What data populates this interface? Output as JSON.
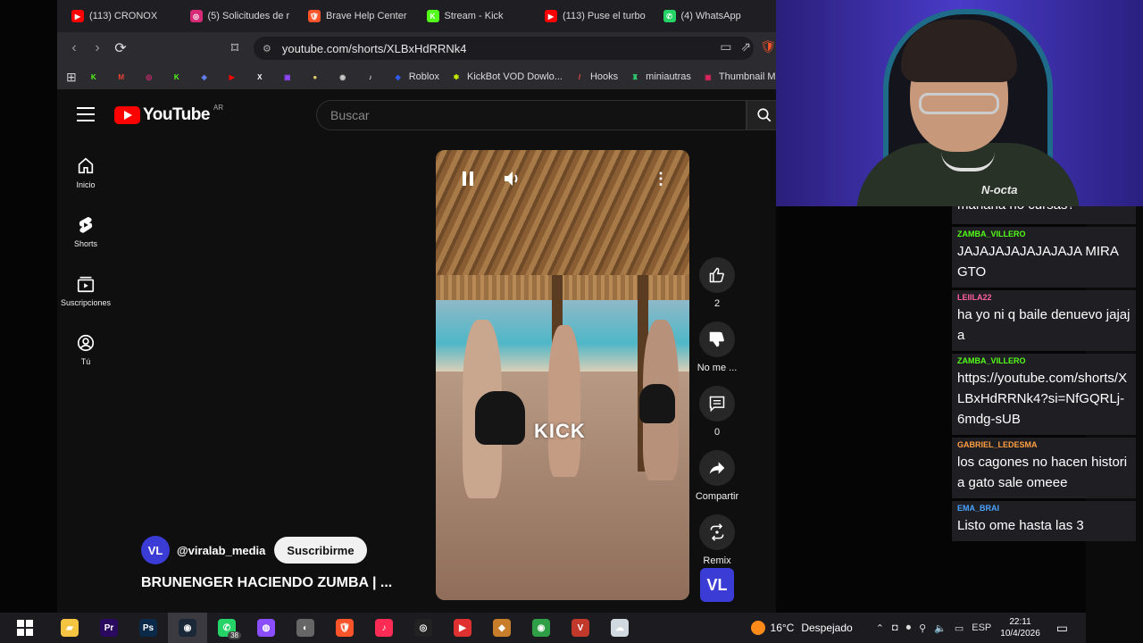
{
  "tabs": [
    {
      "label": "(113) CRONOX",
      "color": "#ff0000",
      "glyph": "▶"
    },
    {
      "label": "(5) Solicitudes de r",
      "color": "#d62976",
      "glyph": "◎"
    },
    {
      "label": "Brave Help Center",
      "color": "#fb542b",
      "glyph": "🛡"
    },
    {
      "label": "Stream - Kick",
      "color": "#53fc18",
      "glyph": "K"
    },
    {
      "label": "(113) Puse el turbo",
      "color": "#ff0000",
      "glyph": "▶"
    },
    {
      "label": "(4) WhatsApp",
      "color": "#25d366",
      "glyph": "✆"
    }
  ],
  "address": {
    "url": "youtube.com/shorts/XLBxHdRRNk4"
  },
  "bookmarks": [
    {
      "label": "",
      "color": "#53fc18",
      "glyph": "K"
    },
    {
      "label": "",
      "color": "#ea4335",
      "glyph": "M"
    },
    {
      "label": "",
      "color": "#d62976",
      "glyph": "◎"
    },
    {
      "label": "",
      "color": "#53fc18",
      "glyph": "K"
    },
    {
      "label": "",
      "color": "#627eea",
      "glyph": "◆"
    },
    {
      "label": "",
      "color": "#ff0000",
      "glyph": "▶"
    },
    {
      "label": "",
      "color": "#ffffff",
      "glyph": "X"
    },
    {
      "label": "",
      "color": "#9146ff",
      "glyph": "▣"
    },
    {
      "label": "",
      "color": "#e7d36a",
      "glyph": "●"
    },
    {
      "label": "",
      "color": "#cccccc",
      "glyph": "◉"
    },
    {
      "label": "",
      "color": "#ffffff",
      "glyph": "♪"
    },
    {
      "label": "Roblox",
      "color": "#335fff",
      "glyph": "◈"
    },
    {
      "label": "KickBot VOD Dowlo...",
      "color": "#c7f000",
      "glyph": "✱"
    },
    {
      "label": "Hooks",
      "color": "#ff4b4b",
      "glyph": "/"
    },
    {
      "label": "miniautras",
      "color": "#2ecc71",
      "glyph": "♜"
    },
    {
      "label": "Thumbnail M",
      "color": "#e0245e",
      "glyph": "▣"
    }
  ],
  "youtube": {
    "logo_text": "YouTube",
    "region": "AR",
    "search_placeholder": "Buscar",
    "nav": [
      {
        "label": "Inicio",
        "icon": "home-icon"
      },
      {
        "label": "Shorts",
        "icon": "shorts-icon"
      },
      {
        "label": "Suscripciones",
        "icon": "subscriptions-icon"
      },
      {
        "label": "Tú",
        "icon": "you-icon"
      }
    ],
    "video": {
      "watermark": "KICK"
    },
    "actions": {
      "likes": "2",
      "dislike": "No me ...",
      "comments": "0",
      "share": "Compartir",
      "remix": "Remix"
    },
    "channel": {
      "avatar_text": "VL",
      "handle": "@viralab_media",
      "subscribe": "Suscribirme"
    },
    "title": "BRUNENGER HACIENDO ZUMBA | ..."
  },
  "webcam": {
    "shirt_text": "N-octa"
  },
  "chat": [
    {
      "user": "",
      "text": "mañana no cursas?",
      "color": "#ffffff",
      "cut": true
    },
    {
      "user": "ZAMBA_VILLERO",
      "text": "JAJAJAJAJAJAJAJA MIRA GTO",
      "color": "#53fc18"
    },
    {
      "user": "LEIILA22",
      "text": "ha yo ni q baile denuevo jajaja",
      "color": "#ff5fa2"
    },
    {
      "user": "ZAMBA_VILLERO",
      "text": "https://youtube.com/shorts/XLBxHdRRNk4?si=NfGQRLj-6mdg-sUB",
      "color": "#53fc18"
    },
    {
      "user": "GABRIEL_LEDESMA",
      "text": "los cagones no hacen historia gato sale omeee",
      "color": "#ff9f43"
    },
    {
      "user": "EMA_BRAI",
      "text": "Listo ome hasta las 3",
      "color": "#4aa3ff"
    }
  ],
  "taskbar": {
    "apps": [
      {
        "name": "file-explorer",
        "color": "#f5c542",
        "glyph": "▰"
      },
      {
        "name": "premiere",
        "color": "#2a0a5e",
        "glyph": "Pr"
      },
      {
        "name": "photoshop",
        "color": "#0b2a4a",
        "glyph": "Ps"
      },
      {
        "name": "steam",
        "color": "#1b2838",
        "glyph": "◉"
      },
      {
        "name": "whatsapp",
        "color": "#25d366",
        "glyph": "✆"
      },
      {
        "name": "messenger",
        "color": "#8a4dff",
        "glyph": "◍"
      },
      {
        "name": "app-grey",
        "color": "#666666",
        "glyph": "◐"
      },
      {
        "name": "brave",
        "color": "#fb542b",
        "glyph": "🛡"
      },
      {
        "name": "tiktok",
        "color": "#fe2c55",
        "glyph": "♪"
      },
      {
        "name": "obs",
        "color": "#222222",
        "glyph": "◎"
      },
      {
        "name": "streamlabs",
        "color": "#e03131",
        "glyph": "▶"
      },
      {
        "name": "app-orange",
        "color": "#c77d2a",
        "glyph": "◆"
      },
      {
        "name": "chrome",
        "color": "#2e9e47",
        "glyph": "◉"
      },
      {
        "name": "voicemeeter",
        "color": "#c0392b",
        "glyph": "V"
      },
      {
        "name": "app-cloud",
        "color": "#d0d8e0",
        "glyph": "☁"
      }
    ],
    "whatsapp_badge": "38",
    "temperature": "16°C",
    "weather": "Despejado",
    "language": "ESP",
    "time": "22:11",
    "date": "10/4/2026"
  },
  "colors": {
    "yt_red": "#ff0000",
    "chat_bg": "#1f1f23",
    "accent": "#3b3bd6"
  }
}
